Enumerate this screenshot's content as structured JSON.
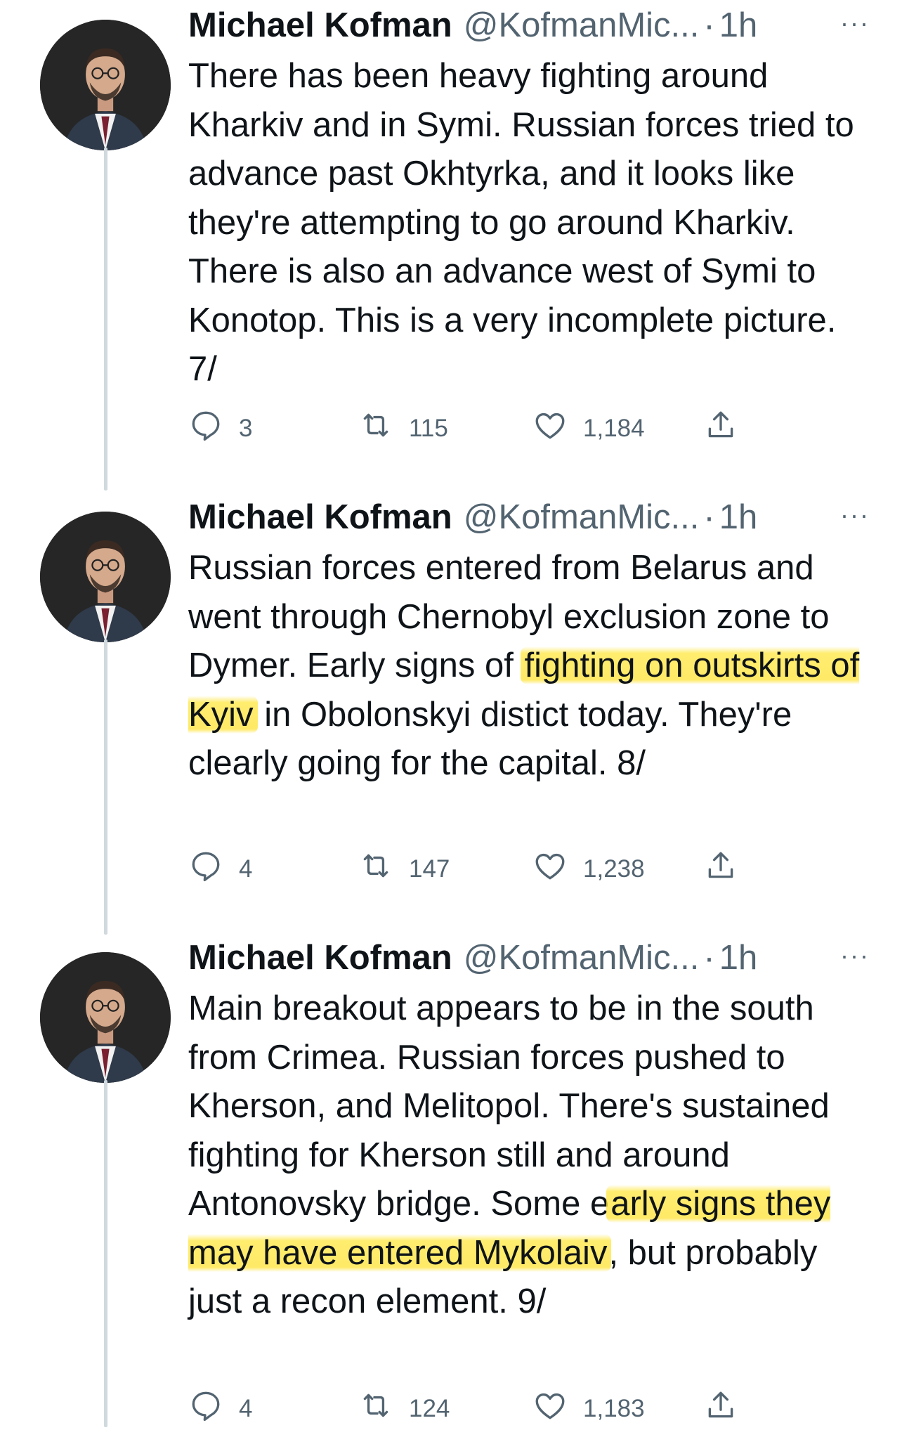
{
  "tweets": [
    {
      "author": "Michael Kofman",
      "handle": "@KofmanMic...",
      "separator": "·",
      "time": "1h",
      "more": "···",
      "text_parts": [
        "There has been heavy fighting around Kharkiv and in Symi. Russian forces tried to advance past Okhtyrka, and it looks like they're attempting to go around Kharkiv. There is also an advance west of Symi to Konotop. This is a very incomplete picture. 7/"
      ],
      "replies": "3",
      "retweets": "115",
      "likes": "1,184"
    },
    {
      "author": "Michael Kofman",
      "handle": "@KofmanMic...",
      "separator": "·",
      "time": "1h",
      "more": "···",
      "text_parts": [
        "Russian forces entered from Belarus and went through Chernobyl exclusion zone to Dymer. Early signs of ",
        "fighting on outskirts of Kyiv",
        " in Obolonskyi distict today. They're clearly going for the capital. 8/"
      ],
      "replies": "4",
      "retweets": "147",
      "likes": "1,238"
    },
    {
      "author": "Michael Kofman",
      "handle": "@KofmanMic...",
      "separator": "·",
      "time": "1h",
      "more": "···",
      "text_parts": [
        "Main breakout appears to be in the south from Crimea. Russian forces pushed to Kherson, and Melitopol. There's sustained fighting for Kherson still and around Antonovsky bridge. Some e",
        "arly signs they may have entered Mykolaiv",
        ", but probably just a recon element. 9/"
      ],
      "replies": "4",
      "retweets": "124",
      "likes": "1,183"
    }
  ],
  "highlight_color": "#ffe446",
  "icons": [
    "reply-icon",
    "retweet-icon",
    "like-icon",
    "share-icon",
    "more-icon"
  ]
}
